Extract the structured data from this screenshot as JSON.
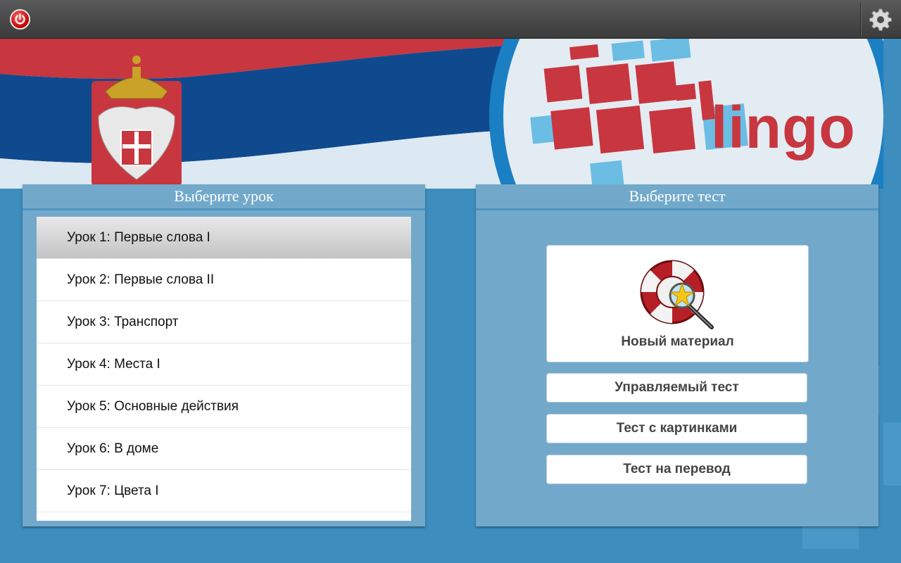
{
  "topbar": {
    "power_icon": "power-icon",
    "settings_icon": "gear-icon"
  },
  "banner": {
    "logo_text": "lingo",
    "colors": {
      "red": "#c8363f",
      "blue": "#0f4a8f",
      "light_blue": "#6bbde4"
    }
  },
  "lessons": {
    "title": "Выберите урок",
    "items": [
      "Урок 1: Первые слова I",
      "Урок 2: Первые слова II",
      "Урок 3: Транспорт",
      "Урок 4: Места I",
      "Урок 5: Основные действия",
      "Урок 6: В доме",
      "Урок 7: Цвета I"
    ],
    "selected_index": 0
  },
  "tests": {
    "title": "Выберите тест",
    "new_material": {
      "label": "Новый материал",
      "icon": "lifebuoy-star-magnifier-icon"
    },
    "guided": "Управляемый тест",
    "pictures": "Тест с картинками",
    "translation": "Тест на перевод"
  }
}
